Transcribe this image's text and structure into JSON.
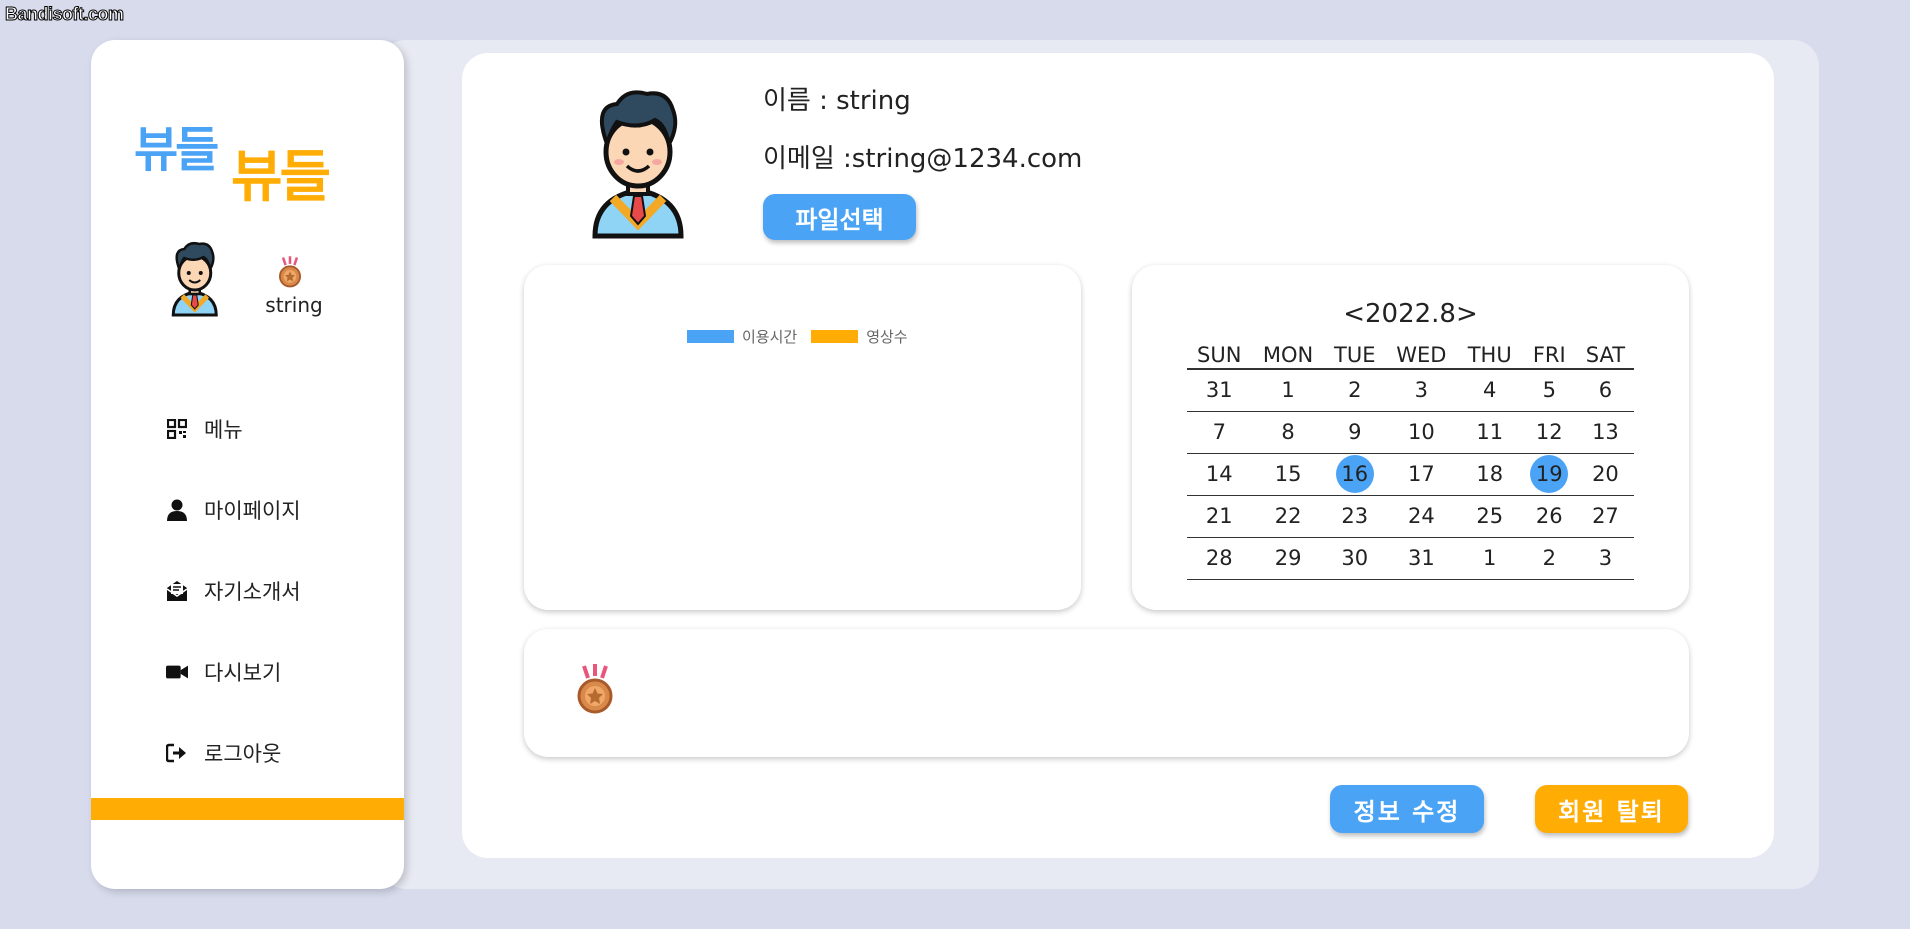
{
  "watermark": "Bandisoft.com",
  "sidebar": {
    "logo": {
      "line1": "뷰들",
      "line2": "뷰들"
    },
    "profile": {
      "name": "string"
    },
    "nav": [
      {
        "label": "메뉴",
        "icon": "qr-menu-icon"
      },
      {
        "label": "마이페이지",
        "icon": "user-icon"
      },
      {
        "label": "자기소개서",
        "icon": "envelope-icon"
      },
      {
        "label": "다시보기",
        "icon": "video-camera-icon"
      },
      {
        "label": "로그아웃",
        "icon": "logout-icon"
      }
    ]
  },
  "profile": {
    "name_line": "이름 : string",
    "email_line": "이메일 :string@1234.com",
    "file_button": "파일선택"
  },
  "chart": {
    "legend": [
      {
        "label": "이용시간",
        "color": "#4aa3f5"
      },
      {
        "label": "영상수",
        "color": "#ffac05"
      }
    ]
  },
  "calendar": {
    "prev": "<",
    "title": "2022.8",
    "next": ">",
    "weekdays": [
      "SUN",
      "MON",
      "TUE",
      "WED",
      "THU",
      "FRI",
      "SAT"
    ],
    "weeks": [
      [
        "31",
        "1",
        "2",
        "3",
        "4",
        "5",
        "6"
      ],
      [
        "7",
        "8",
        "9",
        "10",
        "11",
        "12",
        "13"
      ],
      [
        "14",
        "15",
        "16",
        "17",
        "18",
        "19",
        "20"
      ],
      [
        "21",
        "22",
        "23",
        "24",
        "25",
        "26",
        "27"
      ],
      [
        "28",
        "29",
        "30",
        "31",
        "1",
        "2",
        "3"
      ]
    ],
    "highlighted": [
      "16",
      "19"
    ],
    "highlight_color": "#4aa3f5"
  },
  "buttons": {
    "edit": "정보 수정",
    "withdraw": "회원 탈퇴"
  },
  "colors": {
    "accent_blue": "#4aa3f5",
    "accent_orange": "#ffac05",
    "background": "#d7dbec"
  }
}
